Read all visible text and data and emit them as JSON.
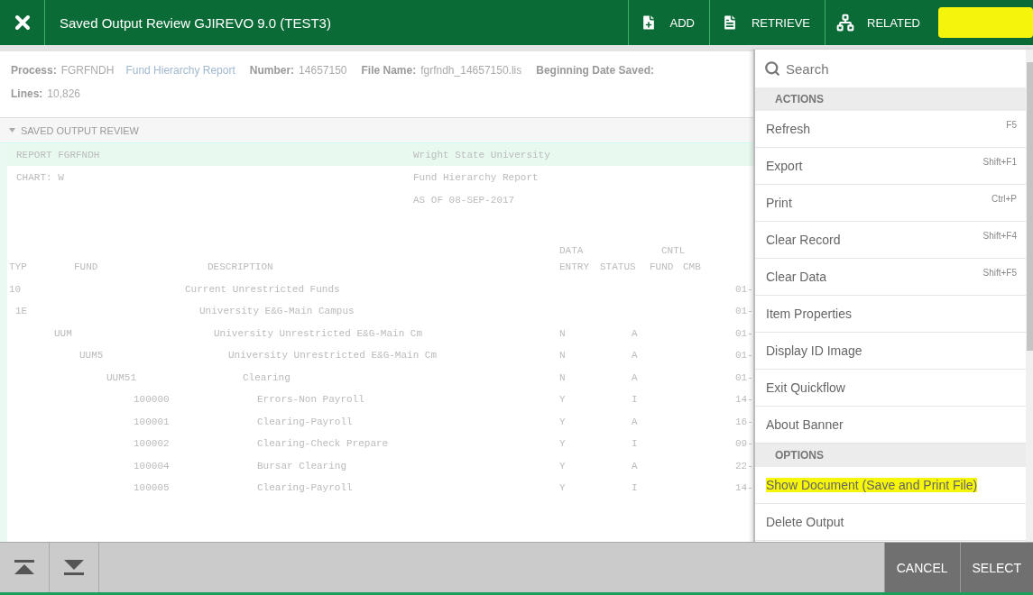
{
  "header": {
    "title": "Saved Output Review GJIREVO 9.0 (TEST3)",
    "actions": [
      {
        "label": "ADD",
        "kind": "add"
      },
      {
        "label": "RETRIEVE",
        "kind": "retrieve"
      },
      {
        "label": "RELATED",
        "kind": "related"
      }
    ]
  },
  "info": {
    "lines": [
      [
        {
          "label": "Process:",
          "value": "FGRFNDH",
          "extra": "Fund Hierarchy Report"
        },
        {
          "label": "Number:",
          "value": "14657150"
        },
        {
          "label": "File Name:",
          "value": "fgrfndh_14657150.lis"
        },
        {
          "label": "Beginning Date Saved:"
        }
      ],
      [
        {
          "label": "Lines:",
          "value": "10,826"
        }
      ]
    ]
  },
  "section": {
    "title": "SAVED OUTPUT REVIEW",
    "expanded": true
  },
  "report": {
    "heading_lines": [
      {
        "left": "REPORT FGRFNDH",
        "center": "Wright State University",
        "selected": true
      },
      {
        "left": "CHART: W",
        "center": "Fund Hierarchy Report",
        "selected": false
      },
      {
        "center": "AS OF 08-SEP-2017",
        "selected": false
      }
    ],
    "column_heads": {
      "top": {
        "entry": "DATA",
        "fund": "CNTL"
      },
      "bottom": {
        "typ": "TYP",
        "code": "FUND",
        "description": "DESCRIPTION",
        "entry": "ENTRY",
        "status": "STATUS",
        "fund": "FUND",
        "cmb": "CMB"
      }
    },
    "rows": [
      {
        "code": "10",
        "description": "Current Unrestricted Funds",
        "date": "01-",
        "children": [
          {
            "code": "1E",
            "description": "University E&G-Main Campus",
            "date": "01-",
            "children": [
              {
                "code": "UUM",
                "description": "University Unrestricted E&G-Main Cm",
                "entry": "N",
                "status": "A",
                "date": "01-",
                "children": [
                  {
                    "code": "UUM5",
                    "description": "University Unrestricted E&G-Main Cm",
                    "entry": "N",
                    "status": "A",
                    "date": "01-",
                    "children": [
                      {
                        "code": "UUM51",
                        "description": "Clearing",
                        "entry": "N",
                        "status": "A",
                        "date": "01-",
                        "children": [
                          {
                            "code": "100000",
                            "description": "Errors-Non Payroll",
                            "entry": "Y",
                            "status": "I",
                            "date": "14-"
                          },
                          {
                            "code": "100001",
                            "description": "Clearing-Payroll",
                            "entry": "Y",
                            "status": "A",
                            "date": "16-"
                          },
                          {
                            "code": "100002",
                            "description": "Clearing-Check Prepare",
                            "entry": "Y",
                            "status": "I",
                            "date": "09-"
                          },
                          {
                            "code": "100004",
                            "description": "Bursar Clearing",
                            "entry": "Y",
                            "status": "A",
                            "date": "22-"
                          },
                          {
                            "code": "100005",
                            "description": "Clearing-Payroll",
                            "entry": "Y",
                            "status": "I",
                            "date": "14-"
                          }
                        ]
                      }
                    ]
                  }
                ]
              }
            ]
          }
        ]
      }
    ]
  },
  "menu": {
    "search": {
      "value": "Search"
    },
    "sections": [
      {
        "title": "ACTIONS",
        "items": [
          {
            "label": "Refresh",
            "shortcut": "F5",
            "highlighted": false
          },
          {
            "label": "Export",
            "shortcut": "Shift+F1",
            "highlighted": false
          },
          {
            "label": "Print",
            "shortcut": "Ctrl+P",
            "highlighted": false
          },
          {
            "label": "Clear Record",
            "shortcut": "Shift+F4",
            "highlighted": false
          },
          {
            "label": "Clear Data",
            "shortcut": "Shift+F5",
            "highlighted": false
          },
          {
            "label": "Item Properties",
            "highlighted": false
          },
          {
            "label": "Display ID Image",
            "highlighted": false
          },
          {
            "label": "Exit Quickflow",
            "highlighted": false
          },
          {
            "label": "About Banner",
            "highlighted": false
          }
        ]
      },
      {
        "title": "OPTIONS",
        "items": [
          {
            "label": "Show Document (Save and Print File)",
            "highlighted": true
          },
          {
            "label": "Delete Output",
            "highlighted": false
          }
        ]
      }
    ]
  },
  "footer": {
    "nav": [
      {
        "kind": "first"
      },
      {
        "kind": "last"
      }
    ],
    "buttons": [
      "CANCEL",
      "SELECT"
    ]
  }
}
